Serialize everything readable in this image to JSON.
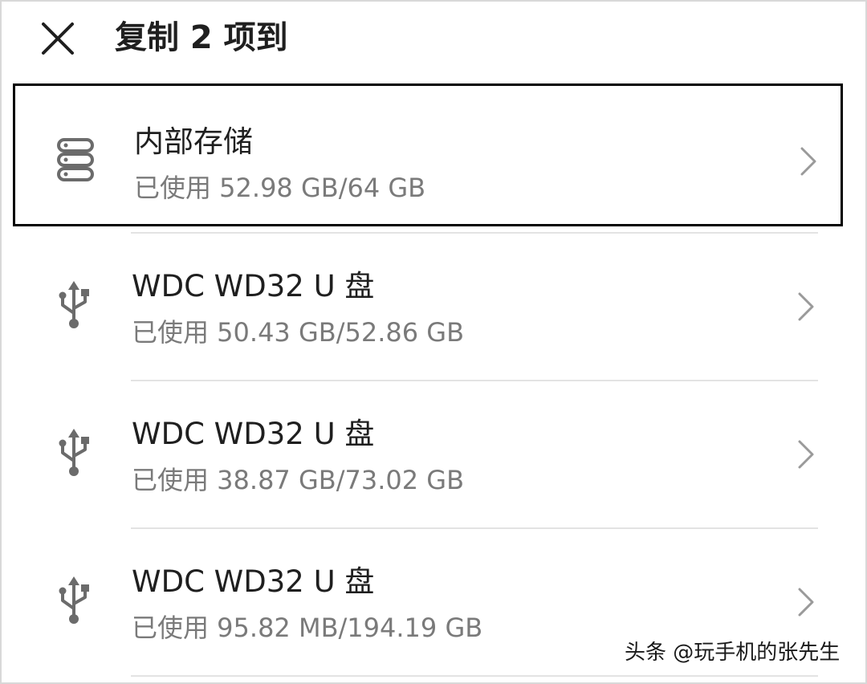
{
  "header": {
    "close_icon": "close-icon",
    "title": "复制 2 项到"
  },
  "storage_list": [
    {
      "icon": "internal-storage-icon",
      "name": "内部存储",
      "usage": "已使用 52.98 GB/64 GB",
      "selected": true
    },
    {
      "icon": "usb-icon",
      "name": "WDC WD32 U 盘",
      "usage": "已使用 50.43 GB/52.86 GB",
      "selected": false
    },
    {
      "icon": "usb-icon",
      "name": "WDC WD32 U 盘",
      "usage": "已使用 38.87 GB/73.02 GB",
      "selected": false
    },
    {
      "icon": "usb-icon",
      "name": "WDC WD32 U 盘",
      "usage": "已使用 95.82 MB/194.19 GB",
      "selected": false
    }
  ],
  "watermark": "头条 @玩手机的张先生",
  "colors": {
    "text_primary": "#1f1f1f",
    "text_secondary": "#7a7a7a",
    "icon": "#6b6b6b",
    "divider": "#e3e3e3",
    "selection_border": "#000000"
  }
}
